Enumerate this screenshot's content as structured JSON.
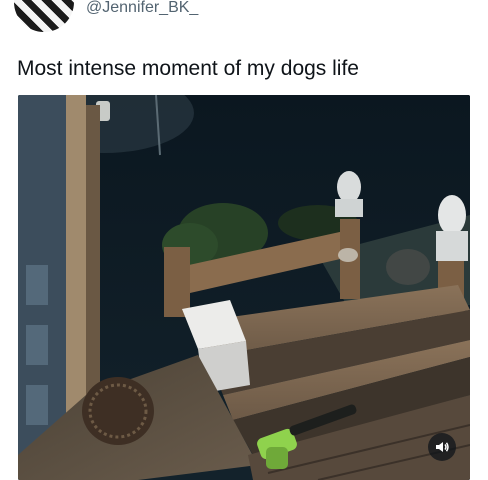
{
  "author": {
    "handle": "@Jennifer_BK_"
  },
  "tweet": {
    "text": "Most intense moment of my dogs life"
  },
  "media": {
    "type": "video",
    "volume_icon": "speaker-icon"
  }
}
